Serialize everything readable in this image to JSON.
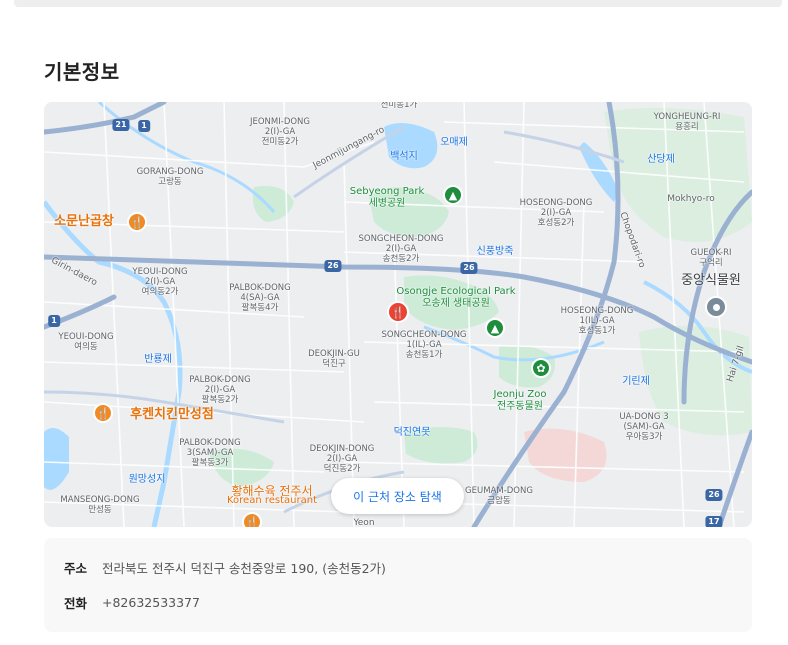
{
  "section": {
    "title": "기본정보"
  },
  "map": {
    "labels": {
      "jeonmi": {
        "name": "JEONMI-DONG",
        "sub1": "2(I)-GA",
        "sub2": "전미동2가"
      },
      "jeonmi_top": {
        "name": "전미동1가"
      },
      "omaeje": {
        "name": "오매제"
      },
      "baekseokji": {
        "name": "백석지"
      },
      "jeonmijungang_ro": {
        "name": "Jeonmijungang-ro"
      },
      "yangheung": {
        "name": "YONGHEUNG-RI",
        "sub": "용흥리"
      },
      "sandangje": {
        "name": "산당제"
      },
      "mokhyo_ro": {
        "name": "Mokhyo-ro"
      },
      "gorang": {
        "name": "GORANG-DONG",
        "sub": "고랑동"
      },
      "sebyeong": {
        "name": "Sebyeong Park",
        "sub": "세병공원"
      },
      "hoseong": {
        "name": "HOSEONG-DONG",
        "sub1": "2(I)-GA",
        "sub2": "호성동2가"
      },
      "chopodari_ro": {
        "name": "Chopodari-ro"
      },
      "somunnan": {
        "name": "소문난곱창"
      },
      "songcheon2": {
        "name": "SONGCHEON-DONG",
        "sub1": "2(I)-GA",
        "sub2": "송천동2가"
      },
      "sinpungje": {
        "name": "신풍방죽"
      },
      "gueok": {
        "name": "GUEOK-RI",
        "sub": "구억리"
      },
      "jungang_arboretum": {
        "name": "중앙식물원"
      },
      "girin_daero": {
        "name": "Girin-daero"
      },
      "yeoui2": {
        "name": "YEOUI-DONG",
        "sub1": "2(I)-GA",
        "sub2": "여의동2가"
      },
      "palbok4": {
        "name": "PALBOK-DONG",
        "sub1": "4(SA)-GA",
        "sub2": "팔복동4가"
      },
      "osongje": {
        "name": "Osongje Ecological Park",
        "sub": "오송제 생태공원"
      },
      "hoseong1": {
        "name": "HOSEONG-DONG",
        "sub1": "1(IL)-GA",
        "sub2": "호성동1가"
      },
      "yeoui": {
        "name": "YEOUI-DONG",
        "sub": "여의동"
      },
      "songcheon1": {
        "name": "SONGCHEON-DONG",
        "sub1": "1(IL)-GA",
        "sub2": "송천동1가"
      },
      "banyongje": {
        "name": "반룡제"
      },
      "deokjin_gu": {
        "name": "DEOKJIN-GU",
        "sub": "덕진구"
      },
      "jeonju_zoo": {
        "name": "Jeonju Zoo",
        "sub": "전주동물원"
      },
      "palbok2": {
        "name": "PALBOK-DONG",
        "sub1": "2(I)-GA",
        "sub2": "팔복동2가"
      },
      "girinje": {
        "name": "기린제"
      },
      "hukenchicken": {
        "name": "후켄치킨만성점"
      },
      "deokjin_pond": {
        "name": "덕진연못"
      },
      "uadong": {
        "name": "UA-DONG 3",
        "sub1": "(SAM)-GA",
        "sub2": "우아동3가"
      },
      "palbok3": {
        "name": "PALBOK-DONG",
        "sub1": "3(SAM)-GA",
        "sub2": "팔복동3가"
      },
      "deokjin2": {
        "name": "DEOKJIN-DONG",
        "sub1": "2(I)-GA",
        "sub2": "덕진동2가"
      },
      "wonmangseongji": {
        "name": "원망성지"
      },
      "hanae": {
        "name": "황해수육 전주서",
        "sub": "Korean restaurant"
      },
      "geumam": {
        "name": "GEUMAM-DONG",
        "sub": "금암동"
      },
      "manseong": {
        "name": "MANSEONG-DONG",
        "sub": "만성동"
      },
      "yeon": {
        "name": "Yeon"
      },
      "hai_gil": {
        "name": "Hai 7-gil"
      }
    },
    "shields": [
      "21",
      "1",
      "26",
      "26",
      "1",
      "26",
      "17"
    ],
    "explore_button": "이 근처 장소 탐색"
  },
  "info": {
    "address_label": "주소",
    "address_value": "전라북도 전주시 덕진구 송천중앙로 190, (송천동2가)",
    "phone_label": "전화",
    "phone_value": "+82632533377"
  }
}
